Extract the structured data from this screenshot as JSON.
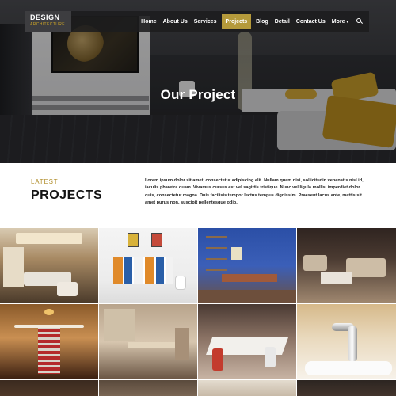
{
  "logo": {
    "title": "DESIGN",
    "subtitle": "ARCHITECTURE"
  },
  "nav": {
    "items": [
      "Home",
      "About Us",
      "Services",
      "Projects",
      "Blog",
      "Detail",
      "Contact Us",
      "More"
    ],
    "active": "Projects",
    "search_icon": "search-icon"
  },
  "hero": {
    "title": "Our Project"
  },
  "intro": {
    "kicker": "LATEST",
    "heading": "PROJECTS",
    "text": "Lorem ipsum dolor sit amet, consectetur adipiscing elit. Nullam quam nisi, sollicitudin venenatis nisl id, iaculis pharetra quam. Vivamus cursus est vel sagittis tristique. Nunc vel ligula mollis, imperdiet dolor quis, consectetur magna. Duis facilisis tempor lectus tempus dignissim. Praesent lacus ante, mattis sit amet purus non, suscipit pellentesque odio."
  },
  "colors": {
    "accent": "#b59a3b",
    "nav_bg": "#1c1c1e",
    "heading": "#141414",
    "kicker": "#b08d2a"
  }
}
